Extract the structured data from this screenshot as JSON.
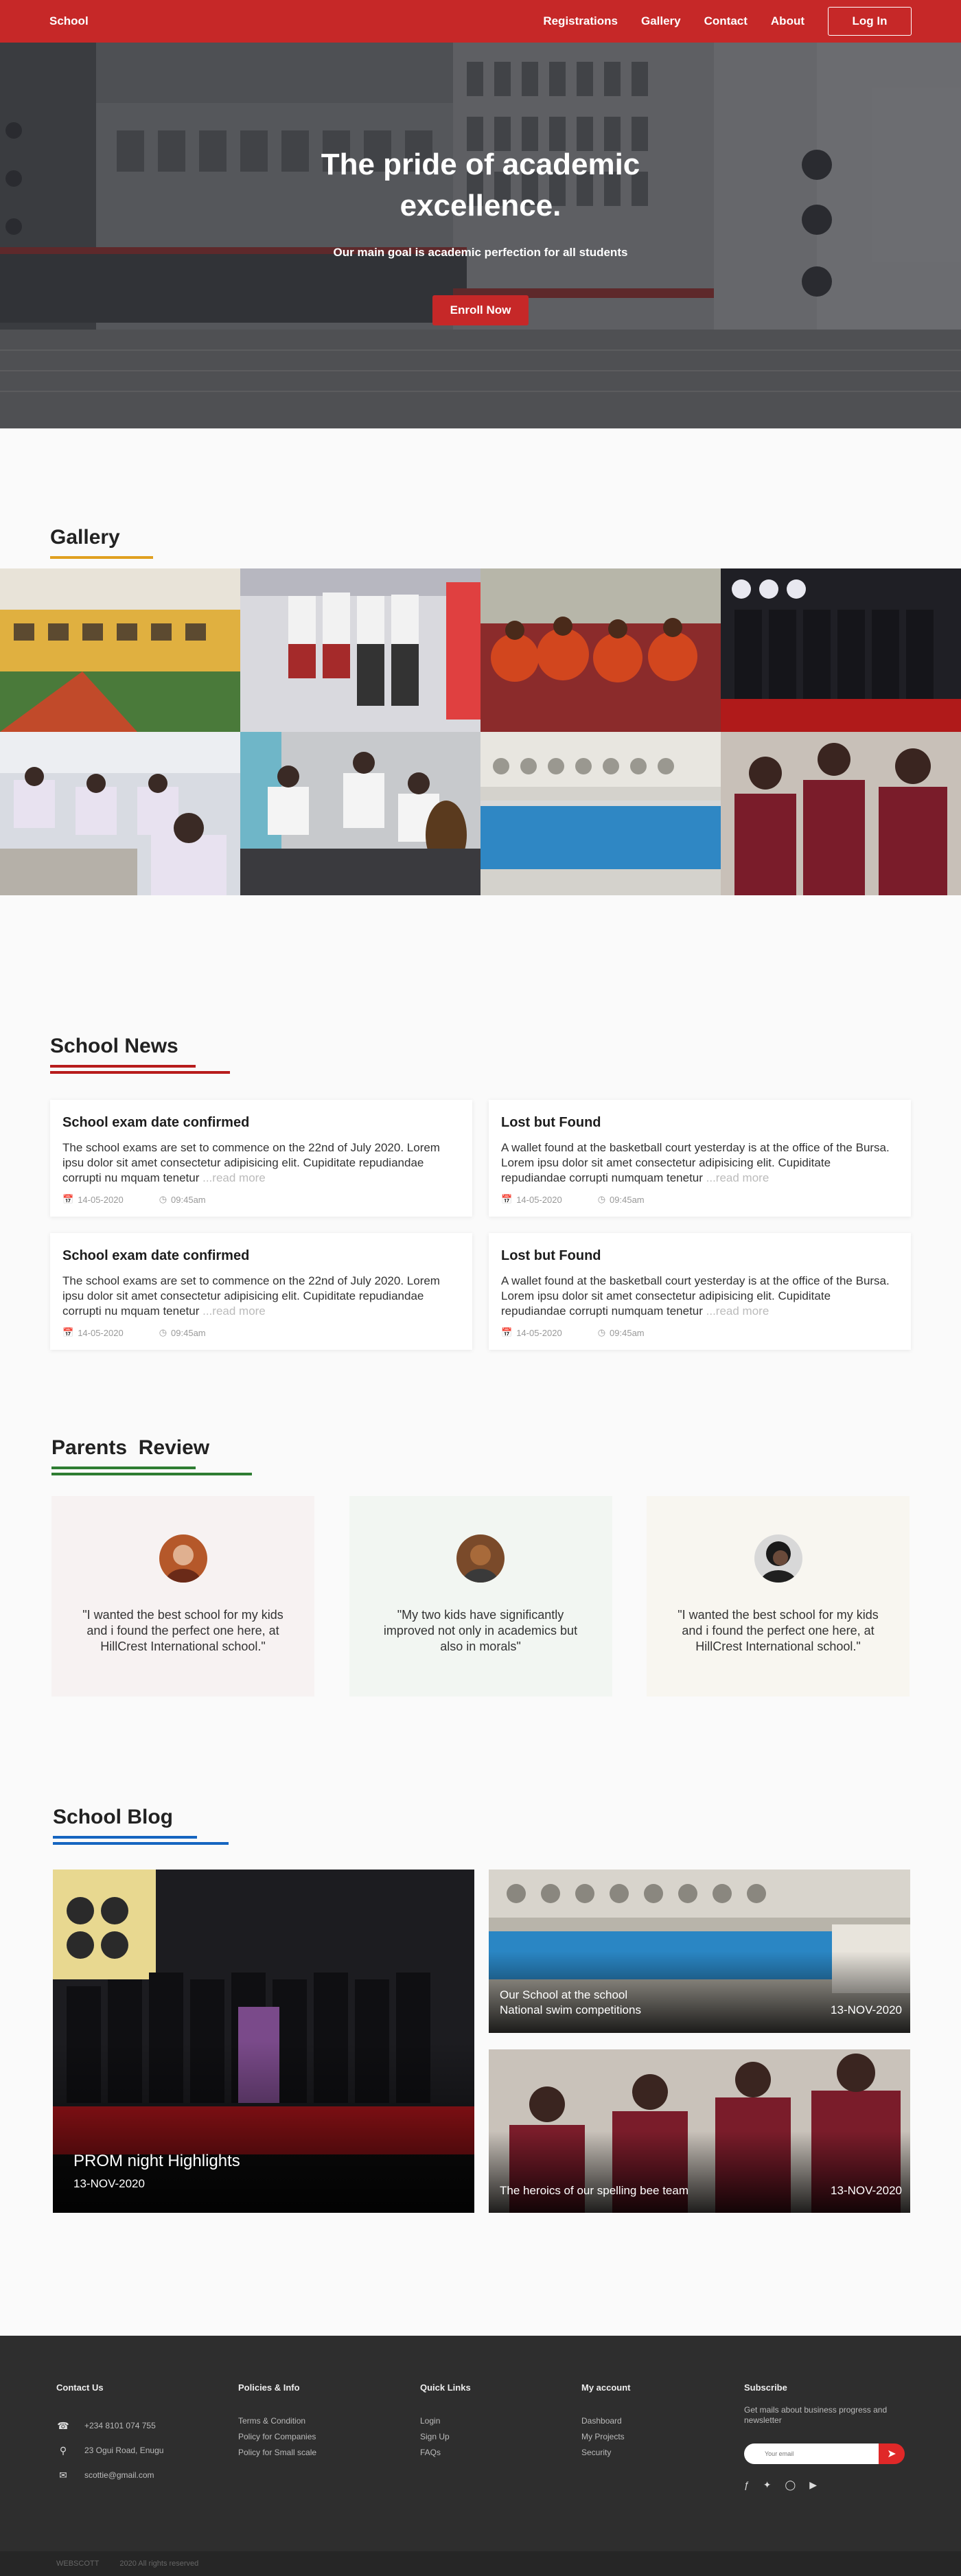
{
  "nav": {
    "brand": "School",
    "links": [
      "Registrations",
      "Gallery",
      "Contact",
      "About"
    ],
    "login": "Log In"
  },
  "hero": {
    "title": "The pride of academic excellence.",
    "subtitle": "Our main goal is academic perfection for all students",
    "cta": "Enroll Now"
  },
  "gallery": {
    "title": "Gallery",
    "accent": "#e0a020"
  },
  "news": {
    "title": "School News",
    "accent": "#b71c1c",
    "more": "...read more",
    "items": [
      {
        "title": "School exam date confirmed",
        "body": "The school exams are set to commence on the 22nd of July 2020. Lorem ipsu dolor sit amet consectetur adipisicing elit. Cupiditate repudiandae corrupti nu mquam tenetur ",
        "date": "14-05-2020",
        "time": "09:45am"
      },
      {
        "title": "Lost but Found",
        "body": "A wallet found at the basketball court yesterday is at the office of the Bursa. Lorem ipsu dolor sit amet consectetur adipisicing elit. Cupiditate repudiandae corrupti numquam tenetur ",
        "date": "14-05-2020",
        "time": "09:45am"
      },
      {
        "title": "School exam date confirmed",
        "body": "The school exams are set to commence on the 22nd of July 2020. Lorem ipsu dolor sit amet consectetur adipisicing elit. Cupiditate repudiandae corrupti nu mquam tenetur ",
        "date": "14-05-2020",
        "time": "09:45am"
      },
      {
        "title": "Lost but Found",
        "body": "A wallet found at the basketball court yesterday is at the office of the Bursa. Lorem ipsu dolor sit amet consectetur adipisicing elit. Cupiditate repudiandae corrupti numquam tenetur ",
        "date": "14-05-2020",
        "time": "09:45am"
      }
    ]
  },
  "reviews": {
    "title": "Parents  Review",
    "accent": "#2e7d32",
    "items": [
      {
        "quote": "\"I wanted the best school for my kids and i found the perfect one here, at HillCrest International school.\"",
        "bg": "#f7f2f2"
      },
      {
        "quote": "\"My two kids have significantly improved not only in academics but also in morals\"",
        "bg": "#f2f6f2"
      },
      {
        "quote": "\"I wanted the best school for my kids and i found the perfect one here, at HillCrest International school.\"",
        "bg": "#f8f6f0"
      }
    ]
  },
  "blog": {
    "title": "School Blog",
    "accent": "#1565c0",
    "main": {
      "title": "PROM night Highlights",
      "date": "13-NOV-2020"
    },
    "side": [
      {
        "title": "Our School at the school National swim competitions",
        "date": "13-NOV-2020"
      },
      {
        "title": "The heroics of our spelling bee team",
        "date": "13-NOV-2020"
      }
    ]
  },
  "footer": {
    "contact": {
      "title": "Contact Us",
      "phone": "+234 8101 074 755",
      "address": "23 Ogui Road, Enugu",
      "email": "scottie@gmail.com"
    },
    "policies": {
      "title": "Policies & Info",
      "items": [
        "Terms & Condition",
        "Policy for Companies",
        "Policy for Small scale"
      ]
    },
    "quick": {
      "title": "Quick Links",
      "items": [
        "Login",
        "Sign Up",
        "FAQs"
      ]
    },
    "account": {
      "title": "My account",
      "items": [
        "Dashboard",
        "My Projects",
        "Security"
      ]
    },
    "subscribe": {
      "title": "Subscribe",
      "text": "Get mails about business progress and newsletter",
      "placeholder": "Your email"
    },
    "bottom": {
      "brand": "WEBSCOTT",
      "rights": "2020 All rights reserved"
    }
  }
}
